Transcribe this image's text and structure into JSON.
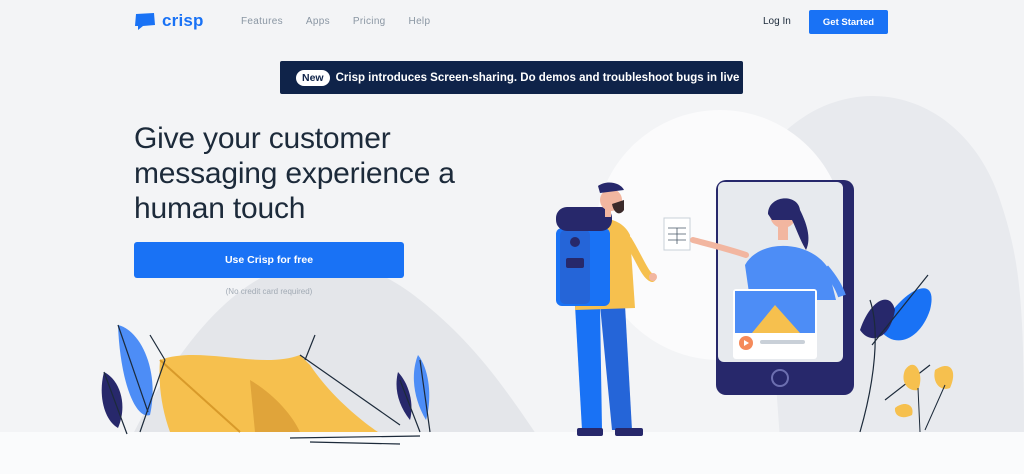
{
  "brand": {
    "name": "crisp",
    "color": "#1972f5"
  },
  "nav": {
    "items": [
      {
        "label": "Features"
      },
      {
        "label": "Apps"
      },
      {
        "label": "Pricing"
      },
      {
        "label": "Help"
      }
    ],
    "login_label": "Log In",
    "get_started_label": "Get Started"
  },
  "announcement": {
    "badge": "New",
    "text": "Crisp introduces Screen-sharing. Do demos and troubleshoot bugs in live",
    "icon": "chevron-right-icon"
  },
  "hero": {
    "title": "Give your customer messaging experience a human touch",
    "cta_label": "Use Crisp for free",
    "note": "(No credit card required)"
  },
  "colors": {
    "primary": "#1972f5",
    "banner_bg": "#0f2349",
    "page_bg": "#f3f4f6",
    "tent": "#f6c04e",
    "phone": "#27286b"
  }
}
